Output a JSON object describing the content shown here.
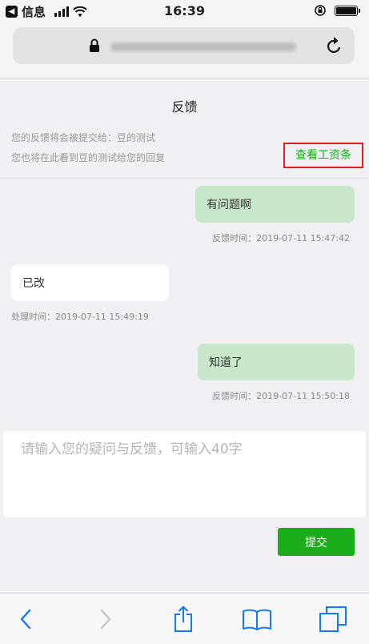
{
  "status_bar": {
    "back_app": "信息",
    "time": "16:39"
  },
  "page": {
    "title": "反馈",
    "info_line_1": "您的反馈将会被提交给：豆的测试",
    "info_line_2": "您也将在此看到豆的测试给您的回复",
    "view_salary_link": "查看工资条"
  },
  "messages": [
    {
      "side": "right",
      "text": "有问题啊",
      "time_label": "反馈时间：2019-07-11 15:47:42"
    },
    {
      "side": "left",
      "text": "已改",
      "time_label": "处理时间：2019-07-11 15:49:19"
    },
    {
      "side": "right",
      "text": "知道了",
      "time_label": "反馈时间：2019-07-11 15:50:18"
    }
  ],
  "input": {
    "placeholder": "请输入您的疑问与反馈，可输入40字",
    "value": ""
  },
  "submit_label": "提交",
  "colors": {
    "accent_green": "#1aad19",
    "bubble_green": "#c8e6c9",
    "highlight_red": "#e02020",
    "toolbar_blue": "#1479ff"
  },
  "toolbar_icons": [
    "back-icon",
    "forward-icon",
    "share-icon",
    "bookmarks-icon",
    "tabs-icon"
  ]
}
